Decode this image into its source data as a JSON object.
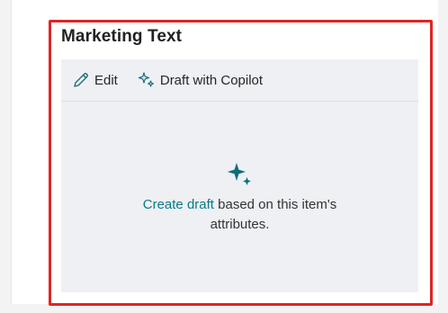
{
  "card": {
    "title": "Marketing Text"
  },
  "toolbar": {
    "edit_label": "Edit",
    "copilot_label": "Draft with Copilot"
  },
  "empty_state": {
    "link_text": "Create draft",
    "rest_text_line1": " based on this item's",
    "rest_text_line2": "attributes."
  },
  "colors": {
    "accent": "#0b7a87",
    "highlight": "#e02424"
  },
  "icons": {
    "edit": "pencil-icon",
    "copilot": "copilot-sparkle-icon",
    "empty": "sparkle-icon"
  }
}
